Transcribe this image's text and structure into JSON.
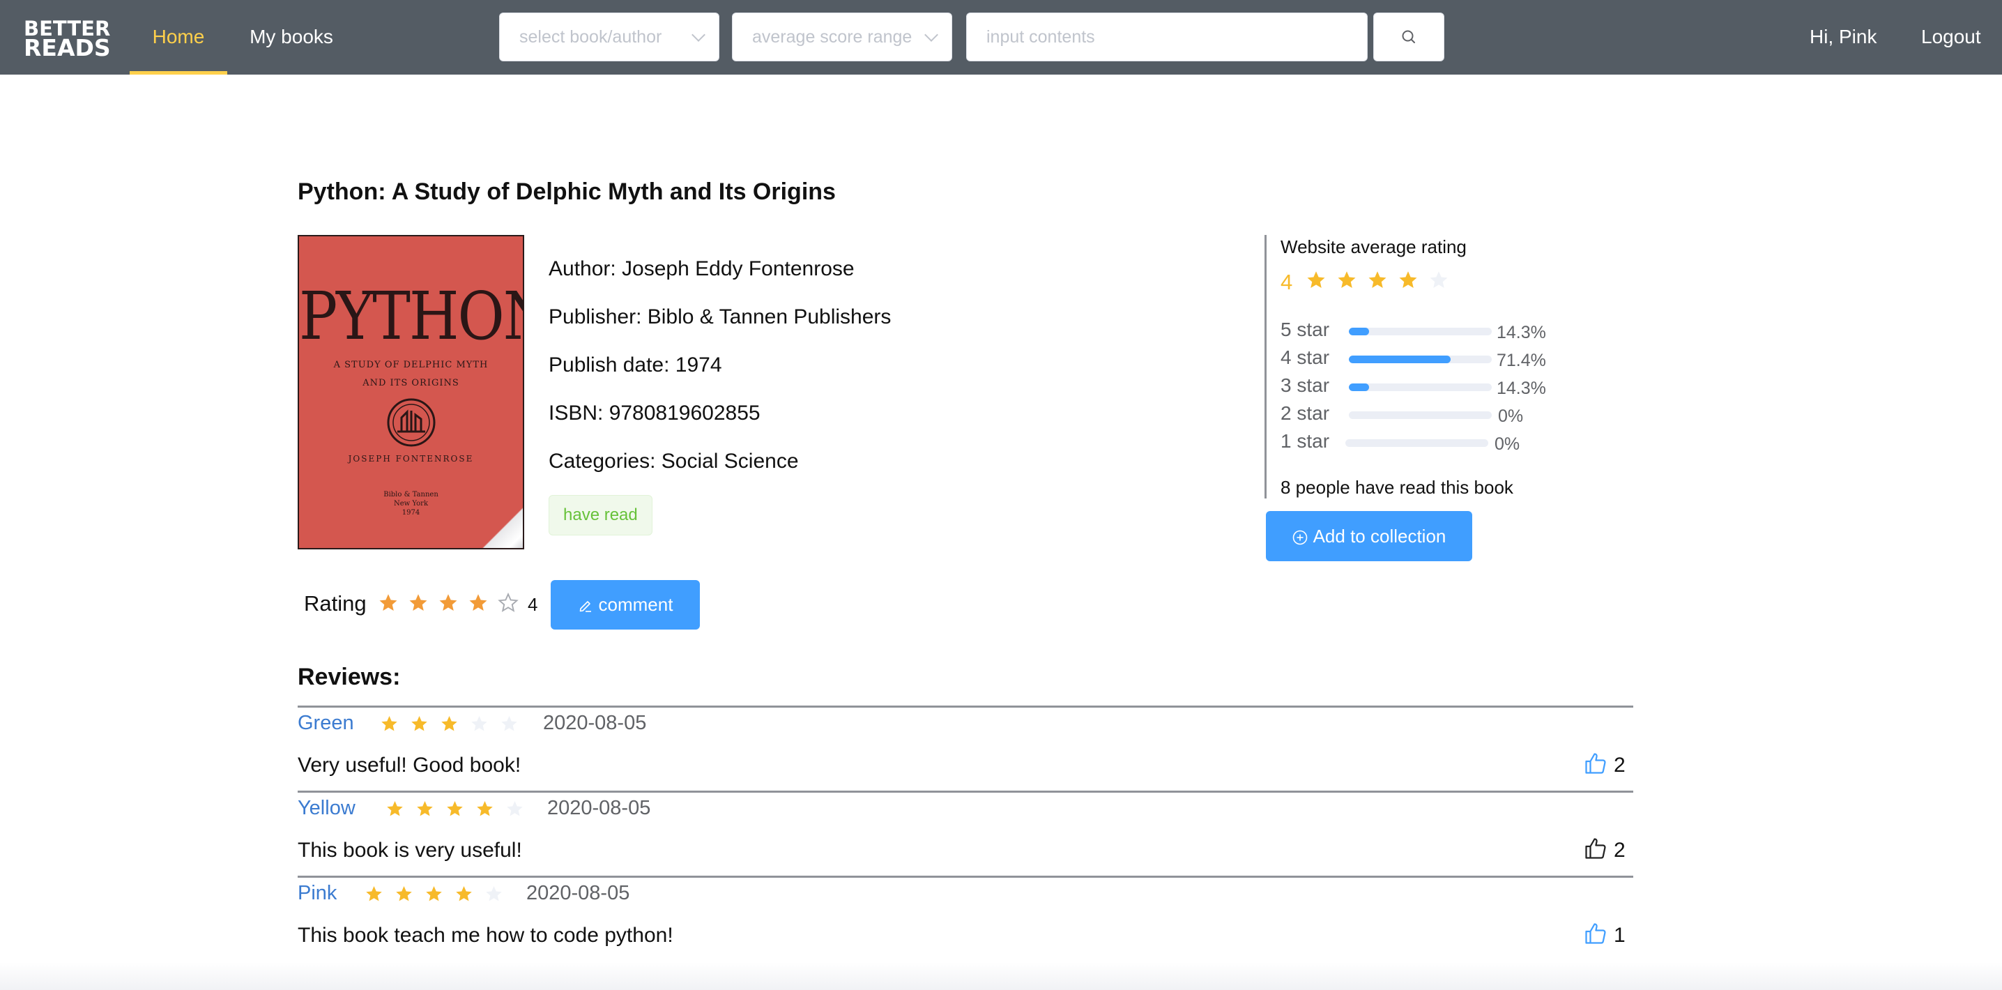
{
  "header": {
    "logo_line1": "BETTER",
    "logo_line2": "READS",
    "nav": [
      {
        "label": "Home",
        "active": true
      },
      {
        "label": "My books",
        "active": false
      }
    ],
    "book_author_select_placeholder": "select book/author",
    "score_range_select_placeholder": "average score range",
    "search_placeholder": "input contents",
    "greeting": "Hi, Pink",
    "logout_label": "Logout",
    "active_color": "#ffd04b",
    "bar_color": "#545c64"
  },
  "book": {
    "title": "Python: A Study of Delphic Myth and Its Origins",
    "cover": {
      "title": "PYTHON",
      "subtitle_line1": "A STUDY OF DELPHIC MYTH",
      "subtitle_line2": "AND ITS ORIGINS",
      "author": "JOSEPH FONTENROSE",
      "publisher_line1": "Biblo & Tannen",
      "publisher_line2": "New York",
      "publisher_line3": "1974"
    },
    "author_line": "Author: Joseph Eddy Fontenrose",
    "publisher_line": "Publisher: Biblo & Tannen Publishers",
    "publish_date_line": "Publish date: 1974",
    "isbn_line": "ISBN: 9780819602855",
    "categories_line": "Categories: Social Science",
    "status_tag": "have read"
  },
  "site_rating": {
    "title": "Website average rating",
    "score": "4",
    "stars_filled": 4,
    "distribution": [
      {
        "label": "5 star",
        "percent_text": "14.3%",
        "fraction": 0.143
      },
      {
        "label": "4 star",
        "percent_text": "71.4%",
        "fraction": 0.714
      },
      {
        "label": "3 star",
        "percent_text": "14.3%",
        "fraction": 0.143
      },
      {
        "label": "2 star",
        "percent_text": "0%",
        "fraction": 0
      },
      {
        "label": "1 star",
        "percent_text": "0%",
        "fraction": 0
      }
    ],
    "readers_text": "8 people have read this book",
    "add_collection_label": "Add to collection"
  },
  "user_rating": {
    "label": "Rating",
    "stars_filled": 4,
    "value": "4",
    "comment_label": "comment"
  },
  "reviews": {
    "heading": "Reviews:",
    "items": [
      {
        "user": "Green",
        "stars": 3,
        "date": "2020-08-05",
        "text": "Very useful! Good book!",
        "likes": "2",
        "liked": true
      },
      {
        "user": "Yellow",
        "stars": 4,
        "date": "2020-08-05",
        "text": "This book is very useful!",
        "likes": "2",
        "liked": false
      },
      {
        "user": "Pink",
        "stars": 4,
        "date": "2020-08-05",
        "text": "This book teach me how to code python!",
        "likes": "1",
        "liked": true
      }
    ]
  },
  "colors": {
    "primary": "#409eff",
    "star_gold": "#f7ba2a",
    "star_orange": "#f29b38",
    "star_empty": "#eff2f7",
    "link_blue": "#3b7bd0"
  }
}
